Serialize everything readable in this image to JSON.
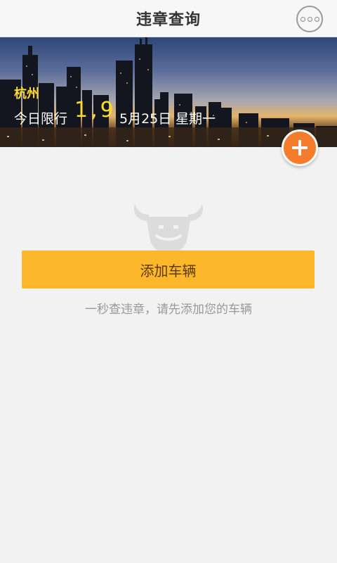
{
  "header": {
    "title": "违章查询",
    "more_icon": "more-dots-icon"
  },
  "banner": {
    "city": "杭州",
    "limit_label": "今日限行",
    "limit_numbers": "1,9",
    "date": "5月25日",
    "weekday": "星期一"
  },
  "fab": {
    "icon": "plus-icon",
    "color": "#f57c2b"
  },
  "empty_state": {
    "mascot_icon": "bull-icon",
    "add_button_label": "添加车辆",
    "hint": "一秒查违章，请先添加您的车辆"
  },
  "colors": {
    "accent": "#fdb72b",
    "highlight": "#ffd92d"
  }
}
